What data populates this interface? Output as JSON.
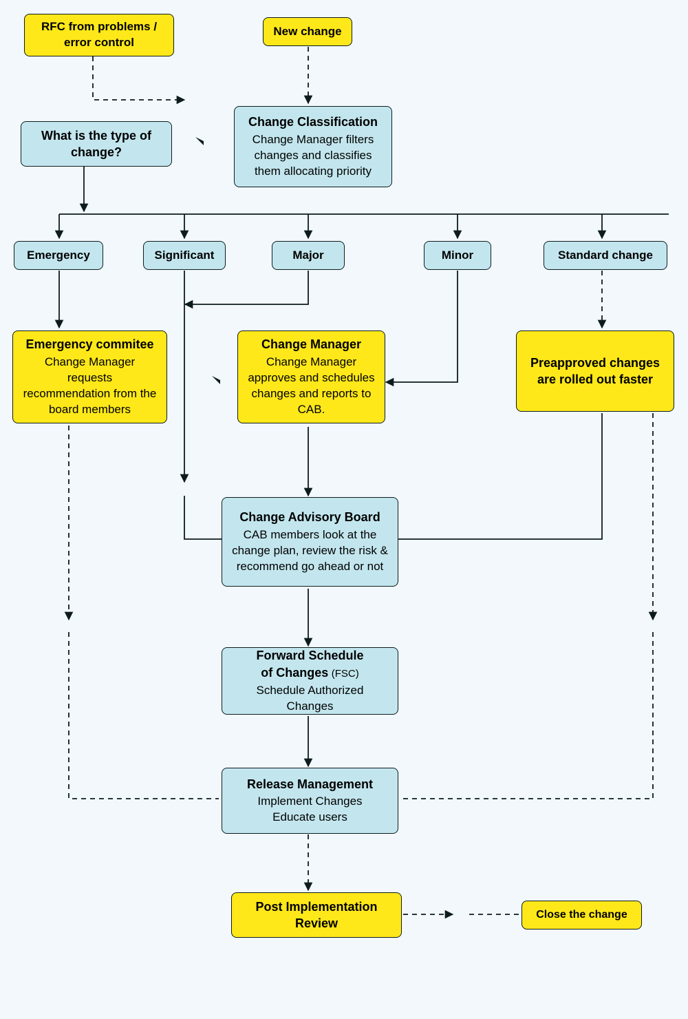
{
  "colors": {
    "yellow": "#fee819",
    "blue": "#c3e6ee",
    "bg": "#f2f8fb"
  },
  "boxes": {
    "rfc": {
      "title": "RFC from problems /\nerror control"
    },
    "new_change": {
      "title": "New change"
    },
    "classification": {
      "title": "Change Classification",
      "sub": "Change Manager filters changes and classifies them allocating priority"
    },
    "type_q": {
      "title": "What is the type of change?"
    },
    "emergency": {
      "title": "Emergency"
    },
    "significant": {
      "title": "Significant"
    },
    "major": {
      "title": "Major"
    },
    "minor": {
      "title": "Minor"
    },
    "standard": {
      "title": "Standard change"
    },
    "emerg_comm": {
      "title": "Emergency commitee",
      "sub": "Change Manager requests recommendation from the board members"
    },
    "change_mgr": {
      "title": "Change Manager",
      "sub": "Change Manager approves and schedules changes and reports to CAB."
    },
    "preapproved": {
      "title": "Preapproved changes are rolled out faster"
    },
    "cab": {
      "title": "Change Advisory Board",
      "sub": "CAB members look at the change plan, review the risk & recommend go ahead or not"
    },
    "fsc": {
      "title_a": "Forward Schedule",
      "title_b": "of Changes",
      "title_c": "(FSC)",
      "sub": "Schedule Authorized Changes"
    },
    "release": {
      "title": "Release Management",
      "sub": "Implement Changes\nEducate users"
    },
    "post_review": {
      "title": "Post Implementation Review"
    },
    "close": {
      "title": "Close the change"
    }
  }
}
